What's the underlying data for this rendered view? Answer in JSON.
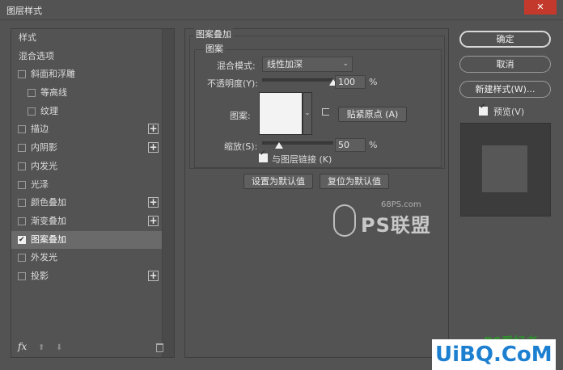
{
  "window": {
    "title": "图层样式",
    "close_glyph": "✕"
  },
  "left_panel": {
    "items": [
      {
        "label": "样式",
        "checkbox": false,
        "checked": false,
        "indent": false,
        "plus": false,
        "active": false
      },
      {
        "label": "混合选项",
        "checkbox": false,
        "checked": false,
        "indent": false,
        "plus": false,
        "active": false
      },
      {
        "label": "斜面和浮雕",
        "checkbox": true,
        "checked": false,
        "indent": false,
        "plus": false,
        "active": false
      },
      {
        "label": "等高线",
        "checkbox": true,
        "checked": false,
        "indent": true,
        "plus": false,
        "active": false
      },
      {
        "label": "纹理",
        "checkbox": true,
        "checked": false,
        "indent": true,
        "plus": false,
        "active": false
      },
      {
        "label": "描边",
        "checkbox": true,
        "checked": false,
        "indent": false,
        "plus": true,
        "active": false
      },
      {
        "label": "内阴影",
        "checkbox": true,
        "checked": false,
        "indent": false,
        "plus": true,
        "active": false
      },
      {
        "label": "内发光",
        "checkbox": true,
        "checked": false,
        "indent": false,
        "plus": false,
        "active": false
      },
      {
        "label": "光泽",
        "checkbox": true,
        "checked": false,
        "indent": false,
        "plus": false,
        "active": false
      },
      {
        "label": "颜色叠加",
        "checkbox": true,
        "checked": false,
        "indent": false,
        "plus": true,
        "active": false
      },
      {
        "label": "渐变叠加",
        "checkbox": true,
        "checked": false,
        "indent": false,
        "plus": true,
        "active": false
      },
      {
        "label": "图案叠加",
        "checkbox": true,
        "checked": true,
        "indent": false,
        "plus": false,
        "active": true
      },
      {
        "label": "外发光",
        "checkbox": true,
        "checked": false,
        "indent": false,
        "plus": false,
        "active": false
      },
      {
        "label": "投影",
        "checkbox": true,
        "checked": false,
        "indent": false,
        "plus": true,
        "active": false
      }
    ],
    "plus_glyph": "+",
    "fx_label": "fx",
    "move_up_glyph": "⬆",
    "move_down_glyph": "⬇"
  },
  "pattern_overlay": {
    "group_title": "图案叠加",
    "sub_title": "图案",
    "blend_mode_label": "混合模式:",
    "blend_mode_value": "线性加深",
    "chevron": "⌄",
    "opacity_label": "不透明度(Y):",
    "opacity_value": "100",
    "opacity_level": 1.0,
    "percent": "%",
    "pattern_label": "图案:",
    "pattern_drop_glyph": "⌄",
    "snap_origin_label": "贴紧原点 (A)",
    "scale_label": "缩放(S):",
    "scale_value": "50",
    "scale_level": 0.5,
    "link_label": "与图层链接 (K)",
    "link_checked": true,
    "make_default_label": "设置为默认值",
    "reset_default_label": "复位为默认值"
  },
  "right_panel": {
    "ok_label": "确定",
    "cancel_label": "取消",
    "new_style_label": "新建样式(W)...",
    "preview_label": "预览(V)",
    "preview_checked": true
  },
  "watermarks": {
    "site": "68PS.com",
    "brand": "PS联盟",
    "corner": "UiBQ.CoM",
    "corner_tag": "PS爱好者"
  },
  "colors": {
    "background": "#535353",
    "active_row": "#6a6a6a",
    "close_button": "#c33a2c",
    "pattern_swatch": "#f3f3f3",
    "corner_blue": "#1d7fd0"
  }
}
